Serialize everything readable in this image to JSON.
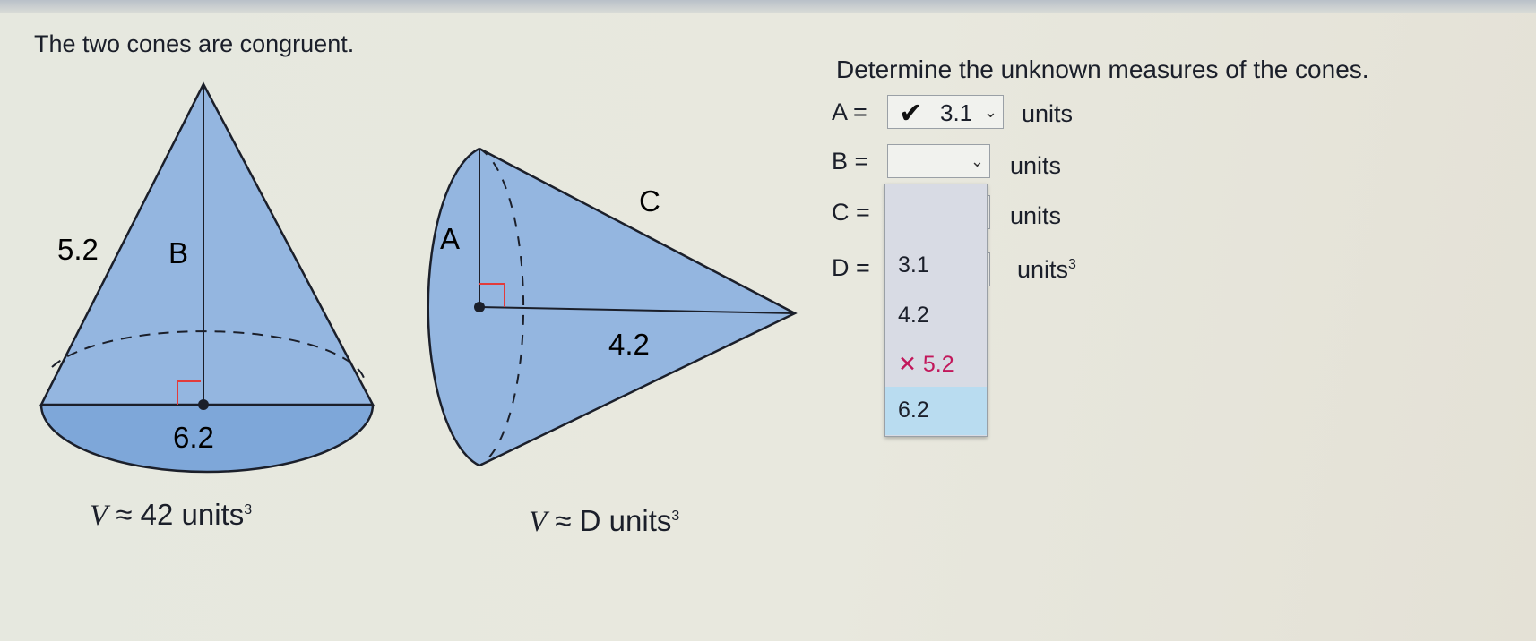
{
  "header": {
    "left_title": "The two cones are congruent.",
    "right_title": "Determine the unknown measures of the cones."
  },
  "cone1": {
    "slant_label": "5.2",
    "height_label": "B",
    "diameter_label": "6.2",
    "volume": {
      "var": "V",
      "approx": "≈",
      "value": "42",
      "units": "units",
      "exp": "3"
    }
  },
  "cone2": {
    "height_label": "A",
    "slant_label": "C",
    "radius_label": "4.2",
    "volume": {
      "var": "V",
      "approx": "≈",
      "value": "D",
      "units": "units",
      "exp": "3"
    }
  },
  "answers": [
    {
      "label": "A =",
      "value": "3.1",
      "status": "correct",
      "units": "units",
      "exp": ""
    },
    {
      "label": "B =",
      "value": "",
      "status": "empty",
      "units": "units",
      "exp": ""
    },
    {
      "label": "C =",
      "value": "",
      "status": "open",
      "units": "units",
      "exp": ""
    },
    {
      "label": "D =",
      "value": "",
      "status": "empty",
      "units": "units",
      "exp": "3"
    }
  ],
  "dropdown": {
    "options": [
      {
        "label": "3.1",
        "mark": ""
      },
      {
        "label": "4.2",
        "mark": ""
      },
      {
        "label": "5.2",
        "mark": "✕"
      },
      {
        "label": "6.2",
        "mark": ""
      }
    ]
  },
  "icons": {
    "check": "✔",
    "chevron": "⌄"
  },
  "colors": {
    "cone_fill": "#89afde",
    "wrong": "#c2185b",
    "highlight": "#b9dcf0",
    "right_angle": "#e23b3b"
  }
}
